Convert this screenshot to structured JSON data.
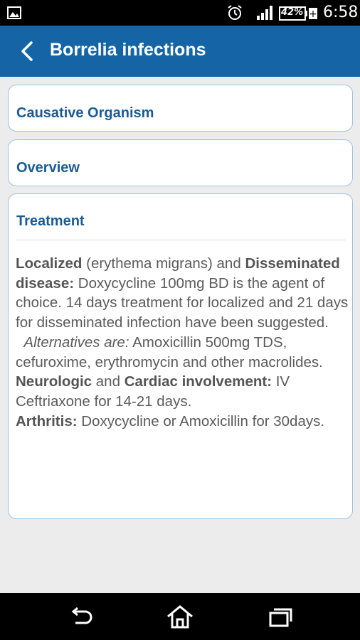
{
  "status_bar": {
    "battery": "42%",
    "time": "6:58"
  },
  "app_bar": {
    "title": "Borrelia infections"
  },
  "sections": {
    "causative_organism": "Causative Organism",
    "overview": "Overview",
    "treatment": "Treatment"
  },
  "treatment": {
    "localized": "Localized",
    "localized_paren": " (erythema migrans) and ",
    "disseminated": "Disseminated disease:",
    "disseminated_text": " Doxycycline 100mg BD is the agent of choice. 14 days treatment for localized and 21 days for disseminated infection have been suggested.",
    "alternatives_label": "Alternatives are:",
    "alternatives_text": " Amoxicillin 500mg TDS, cefuroxime, erythromycin and other macrolides.",
    "neurologic": "Neurologic",
    "and": " and ",
    "cardiac": "Cardiac involvement:",
    "neuro_cardiac_text": " IV Ceftriaxone for 14-21 days.",
    "arthritis": "Arthritis:",
    "arthritis_text": " Doxycycline or Amoxicillin for 30days."
  }
}
